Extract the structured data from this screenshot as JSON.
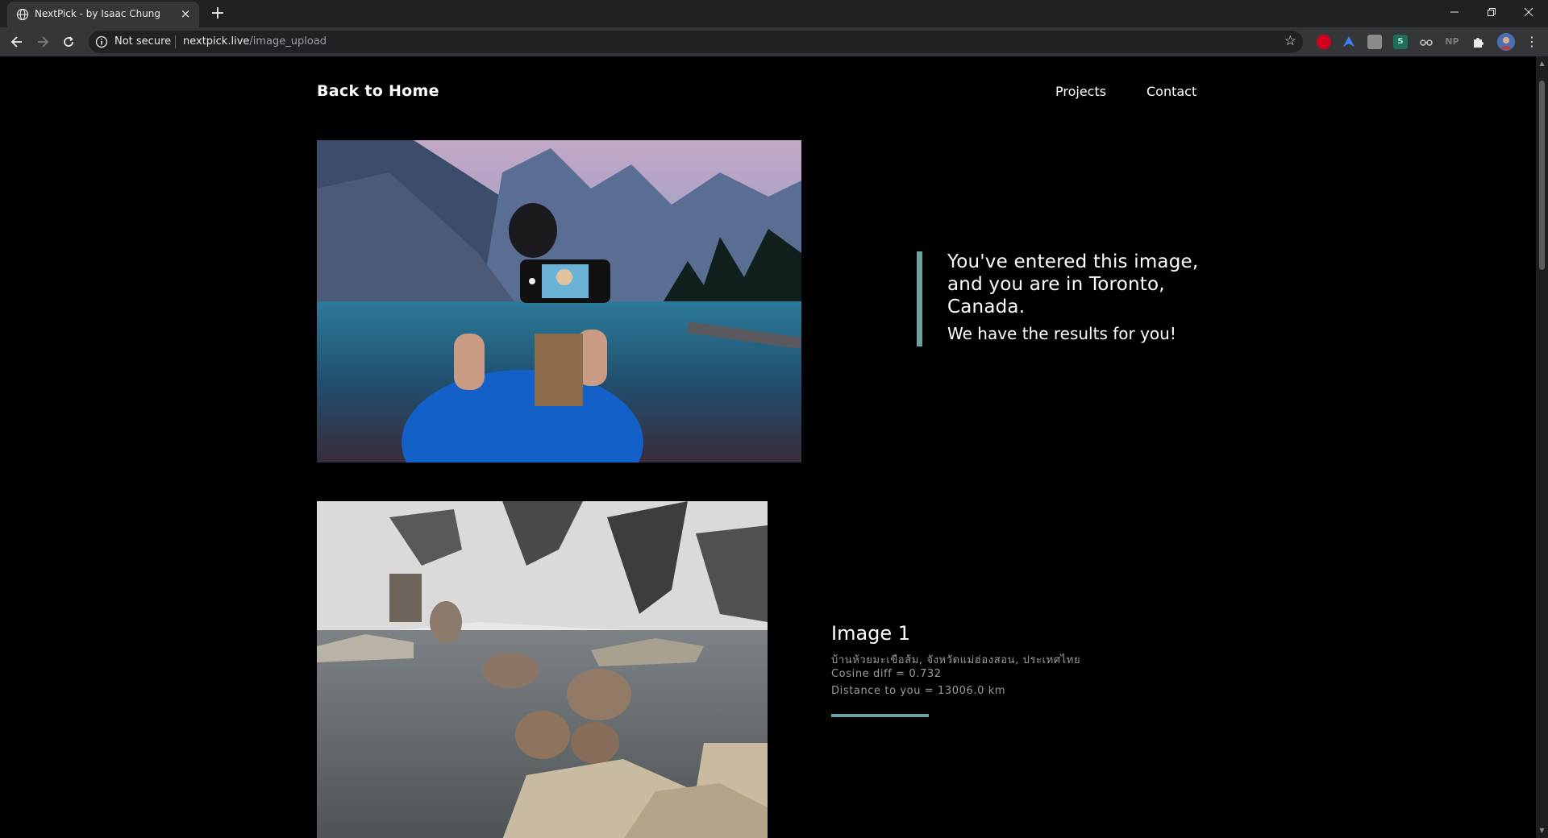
{
  "browser": {
    "tab_title": "NextPick - by Isaac Chung",
    "tab_close": "×",
    "new_tab": "+",
    "security_label": "Not secure",
    "url_host": "nextpick.live",
    "url_path": "/image_upload",
    "extensions": [
      "NP"
    ]
  },
  "nav": {
    "back_home": "Back to Home",
    "links": [
      "Projects",
      "Contact"
    ]
  },
  "hero": {
    "message_main": "You've entered this image, and you are in Toronto, Canada.",
    "message_sub": "We have the results for you!"
  },
  "results": [
    {
      "title": "Image 1",
      "location": "บ้านห้วยมะเขือส้ม, จังหวัดแม่ฮ่องสอน, ประเทศไทย",
      "cosine": "Cosine diff = 0.732",
      "distance": "Distance to you = 13006.0 km"
    }
  ],
  "colors": {
    "accent": "#6aa39f",
    "background": "#000000",
    "chrome_dark": "#202124",
    "chrome_light": "#35363a"
  }
}
